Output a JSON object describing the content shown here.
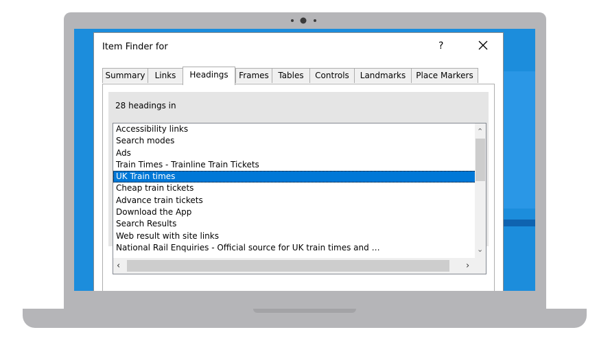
{
  "dialog": {
    "title": "Item Finder for",
    "help_label": "?",
    "close_label": "close"
  },
  "tabs": [
    {
      "label": "Summary"
    },
    {
      "label": "Links"
    },
    {
      "label": "Headings",
      "active": true
    },
    {
      "label": "Frames"
    },
    {
      "label": "Tables"
    },
    {
      "label": "Controls"
    },
    {
      "label": "Landmarks"
    },
    {
      "label": "Place Markers"
    }
  ],
  "summary": {
    "text": "28 headings in"
  },
  "headings_list": {
    "items": [
      "Accessibility links",
      "Search modes",
      "Ads",
      "Train Times - Trainline Train Tickets",
      "UK Train times",
      "Cheap train tickets",
      "Advance train tickets",
      "Download the App",
      "Search Results",
      "Web result with site links",
      "National Rail Enquiries - Official source for UK train times and …"
    ],
    "selected_item": "UK Train times"
  },
  "colors": {
    "selection": "#0078d7",
    "desktop": "#1c8ddc"
  }
}
